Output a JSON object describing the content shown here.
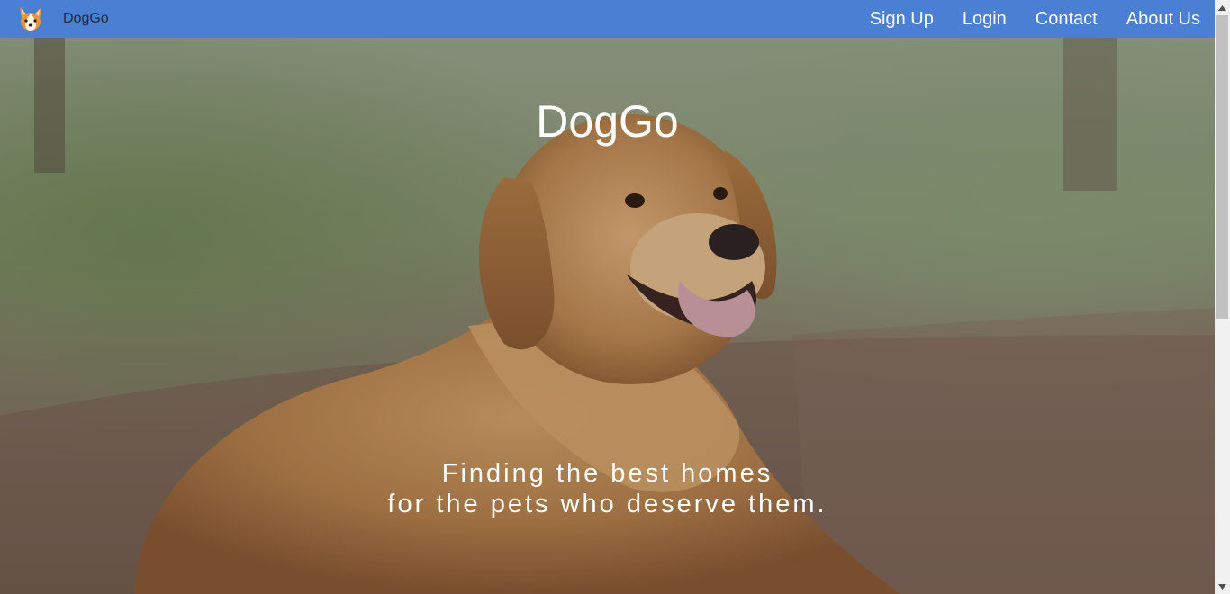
{
  "navbar": {
    "brand_name": "DogGo",
    "logo_icon": "corgi-icon",
    "links": [
      "Sign Up",
      "Login",
      "Contact",
      "About Us"
    ],
    "background_color": "#4a7fd4"
  },
  "hero": {
    "title": "DogGo",
    "tagline_line1": "Finding the best homes",
    "tagline_line2": "for the pets who deserve them.",
    "image_subject": "golden retriever lying on a forest path"
  },
  "scrollbar": {
    "position_fraction": 0.0
  }
}
